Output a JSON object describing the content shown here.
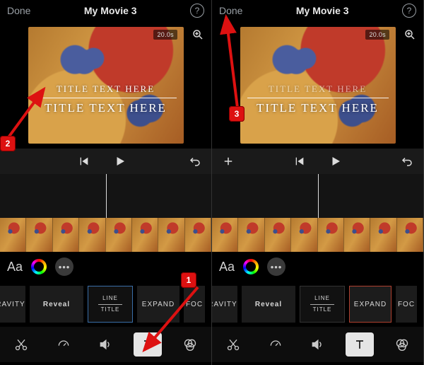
{
  "header": {
    "done_label": "Done",
    "title": "My Movie 3",
    "help_label": "?"
  },
  "preview": {
    "duration_badge": "20.0s",
    "title_line1": "TITLE TEXT HERE",
    "title_line2": "TITLE TEXT HERE"
  },
  "style_row": {
    "font_control": "Aa"
  },
  "presets": {
    "items": [
      {
        "label": "RAVITY"
      },
      {
        "label": "Reveal"
      },
      {
        "label_top": "LINE",
        "label_bot": "TITLE"
      },
      {
        "label": "EXPAND"
      },
      {
        "label": "FOC"
      }
    ]
  },
  "annotations": {
    "marker1": "1",
    "marker2": "2",
    "marker3": "3"
  }
}
